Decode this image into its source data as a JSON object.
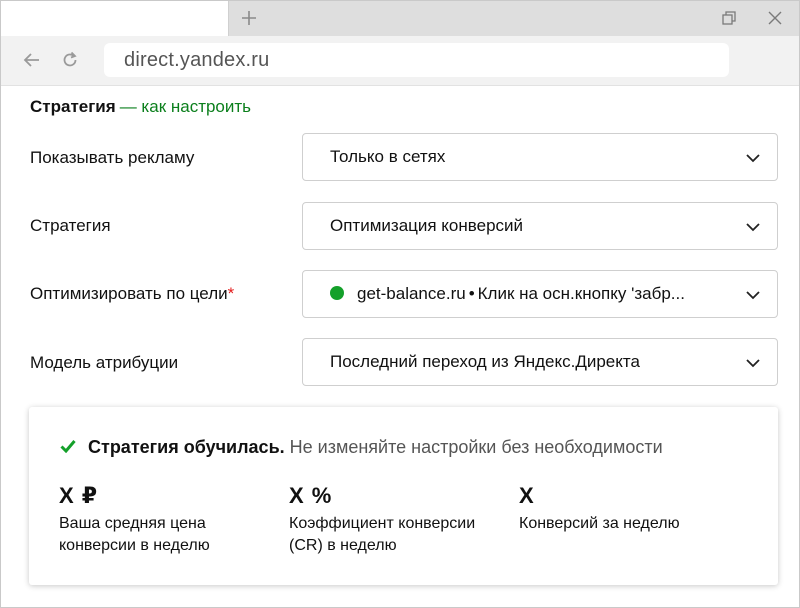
{
  "browser": {
    "new_tab_icon": "plus-icon",
    "address": "direct.yandex.ru",
    "back_icon": "arrow-left-icon",
    "reload_icon": "reload-icon",
    "restore_icon": "restore-window-icon",
    "close_icon": "close-icon"
  },
  "page": {
    "title": "Стратегия",
    "title_sep": "—",
    "title_link": "как настроить"
  },
  "form": {
    "rows": [
      {
        "label": "Показывать рекламу",
        "value": "Только в сетях"
      },
      {
        "label": "Стратегия",
        "value": "Оптимизация конверсий"
      },
      {
        "label": "Оптимизировать по цели",
        "required_mark": "*",
        "value_site": "get-balance.ru",
        "value_sep": "•",
        "value_goal": "Клик на осн.кнопку 'забр..."
      },
      {
        "label": "Модель атрибуции",
        "value": "Последний переход из Яндекс.Директа"
      }
    ]
  },
  "card": {
    "status_bold": "Стратегия обучилась.",
    "status_rest": "Не изменяйте настройки без необходимости",
    "metrics": [
      {
        "value": "X ₽",
        "label": "Ваша средняя цена конверсии в неделю"
      },
      {
        "value": "X %",
        "label": "Коэффициент конверсии (CR) в неделю"
      },
      {
        "value": "X",
        "label": "Конверсий за неделю"
      }
    ]
  },
  "colors": {
    "accent_green": "#0b7f1c",
    "dot_green": "#14a02a",
    "required_red": "#e41b1b"
  }
}
